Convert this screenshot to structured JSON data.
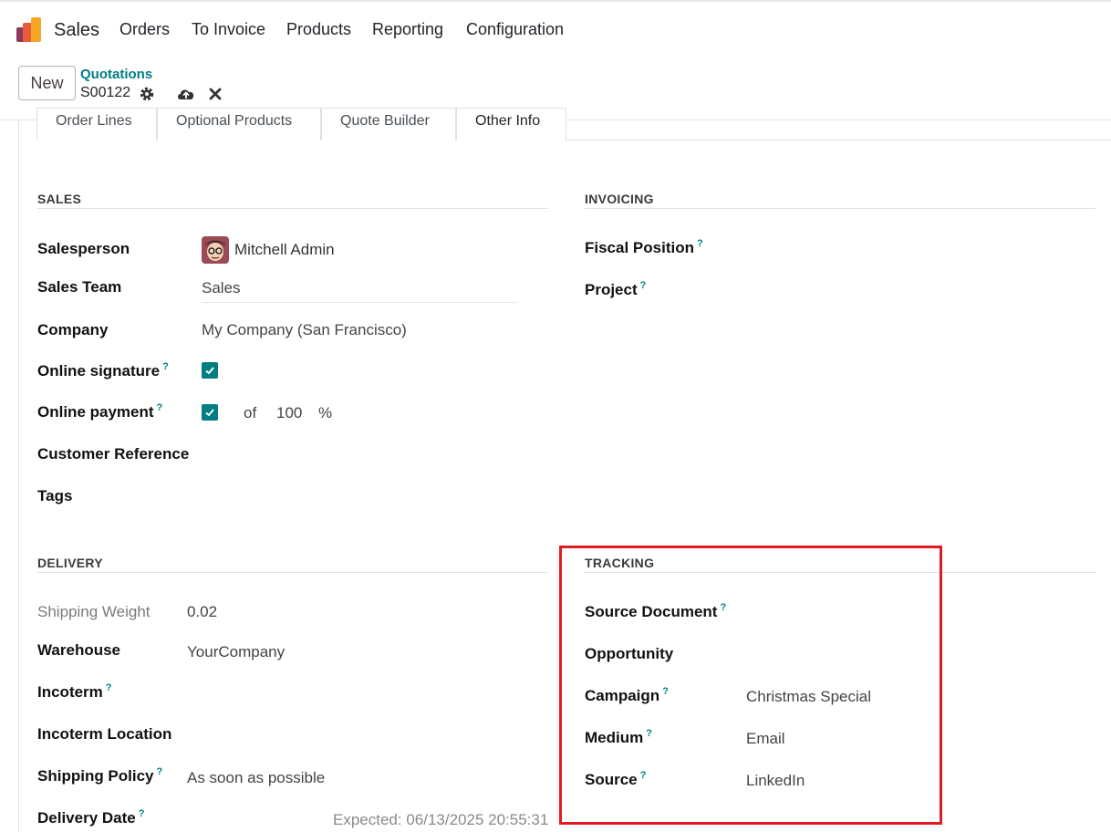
{
  "navbar": {
    "app": "Sales",
    "menu": [
      "Orders",
      "To Invoice",
      "Products",
      "Reporting",
      "Configuration"
    ]
  },
  "control": {
    "new_label": "New",
    "breadcrumb_parent": "Quotations",
    "record": "S00122"
  },
  "tabs": [
    "Order Lines",
    "Optional Products",
    "Quote Builder",
    "Other Info"
  ],
  "sales": {
    "title": "SALES",
    "salesperson_label": "Salesperson",
    "salesperson_value": "Mitchell Admin",
    "team_label": "Sales Team",
    "team_value": "Sales",
    "company_label": "Company",
    "company_value": "My Company (San Francisco)",
    "signature_label": "Online signature",
    "payment_label": "Online payment",
    "payment_of": "of",
    "payment_amount": "100",
    "payment_unit": "%",
    "customer_ref_label": "Customer Reference",
    "tags_label": "Tags"
  },
  "invoicing": {
    "title": "INVOICING",
    "fiscal_label": "Fiscal Position",
    "project_label": "Project"
  },
  "delivery": {
    "title": "DELIVERY",
    "weight_label": "Shipping Weight",
    "weight_value": "0.02",
    "warehouse_label": "Warehouse",
    "warehouse_value": "YourCompany",
    "incoterm_label": "Incoterm",
    "incoterm_location_label": "Incoterm Location",
    "policy_label": "Shipping Policy",
    "policy_value": "As soon as possible",
    "date_label": "Delivery Date",
    "date_expected": "Expected: 06/13/2025 20:55:31"
  },
  "tracking": {
    "title": "TRACKING",
    "source_doc_label": "Source Document",
    "opportunity_label": "Opportunity",
    "campaign_label": "Campaign",
    "campaign_value": "Christmas Special",
    "medium_label": "Medium",
    "medium_value": "Email",
    "source_label": "Source",
    "source_value": "LinkedIn"
  },
  "help_mark": "?",
  "colors": {
    "accent": "#017e84",
    "highlight": "#e01b24"
  }
}
